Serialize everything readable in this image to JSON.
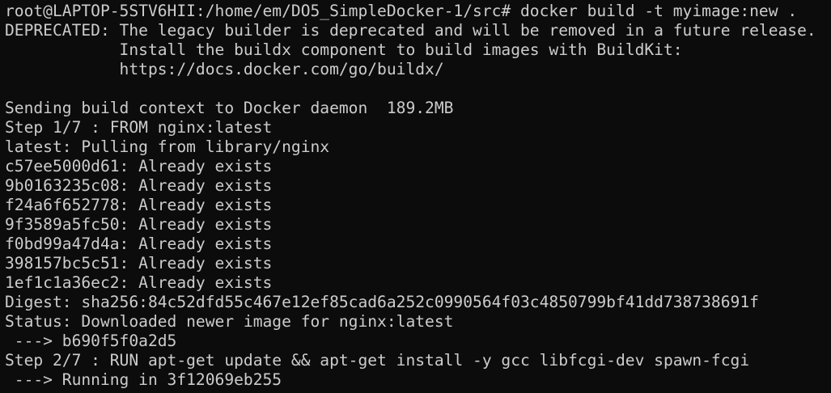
{
  "terminal": {
    "colors": {
      "background": "#0c0c0c",
      "foreground": "#cccccc"
    },
    "prompt": "root@LAPTOP-5STV6HII:/home/em/DO5_SimpleDocker-1/src#",
    "command": " docker build -t myimage:new .",
    "lines": [
      "DEPRECATED: The legacy builder is deprecated and will be removed in a future release.",
      "            Install the buildx component to build images with BuildKit:",
      "            https://docs.docker.com/go/buildx/",
      "",
      "Sending build context to Docker daemon  189.2MB",
      "Step 1/7 : FROM nginx:latest",
      "latest: Pulling from library/nginx",
      "c57ee5000d61: Already exists",
      "9b0163235c08: Already exists",
      "f24a6f652778: Already exists",
      "9f3589a5fc50: Already exists",
      "f0bd99a47d4a: Already exists",
      "398157bc5c51: Already exists",
      "1ef1c1a36ec2: Already exists",
      "Digest: sha256:84c52dfd55c467e12ef85cad6a252c0990564f03c4850799bf41dd738738691f",
      "Status: Downloaded newer image for nginx:latest",
      " ---> b690f5f0a2d5",
      "Step 2/7 : RUN apt-get update && apt-get install -y gcc libfcgi-dev spawn-fcgi",
      " ---> Running in 3f12069eb255"
    ]
  }
}
